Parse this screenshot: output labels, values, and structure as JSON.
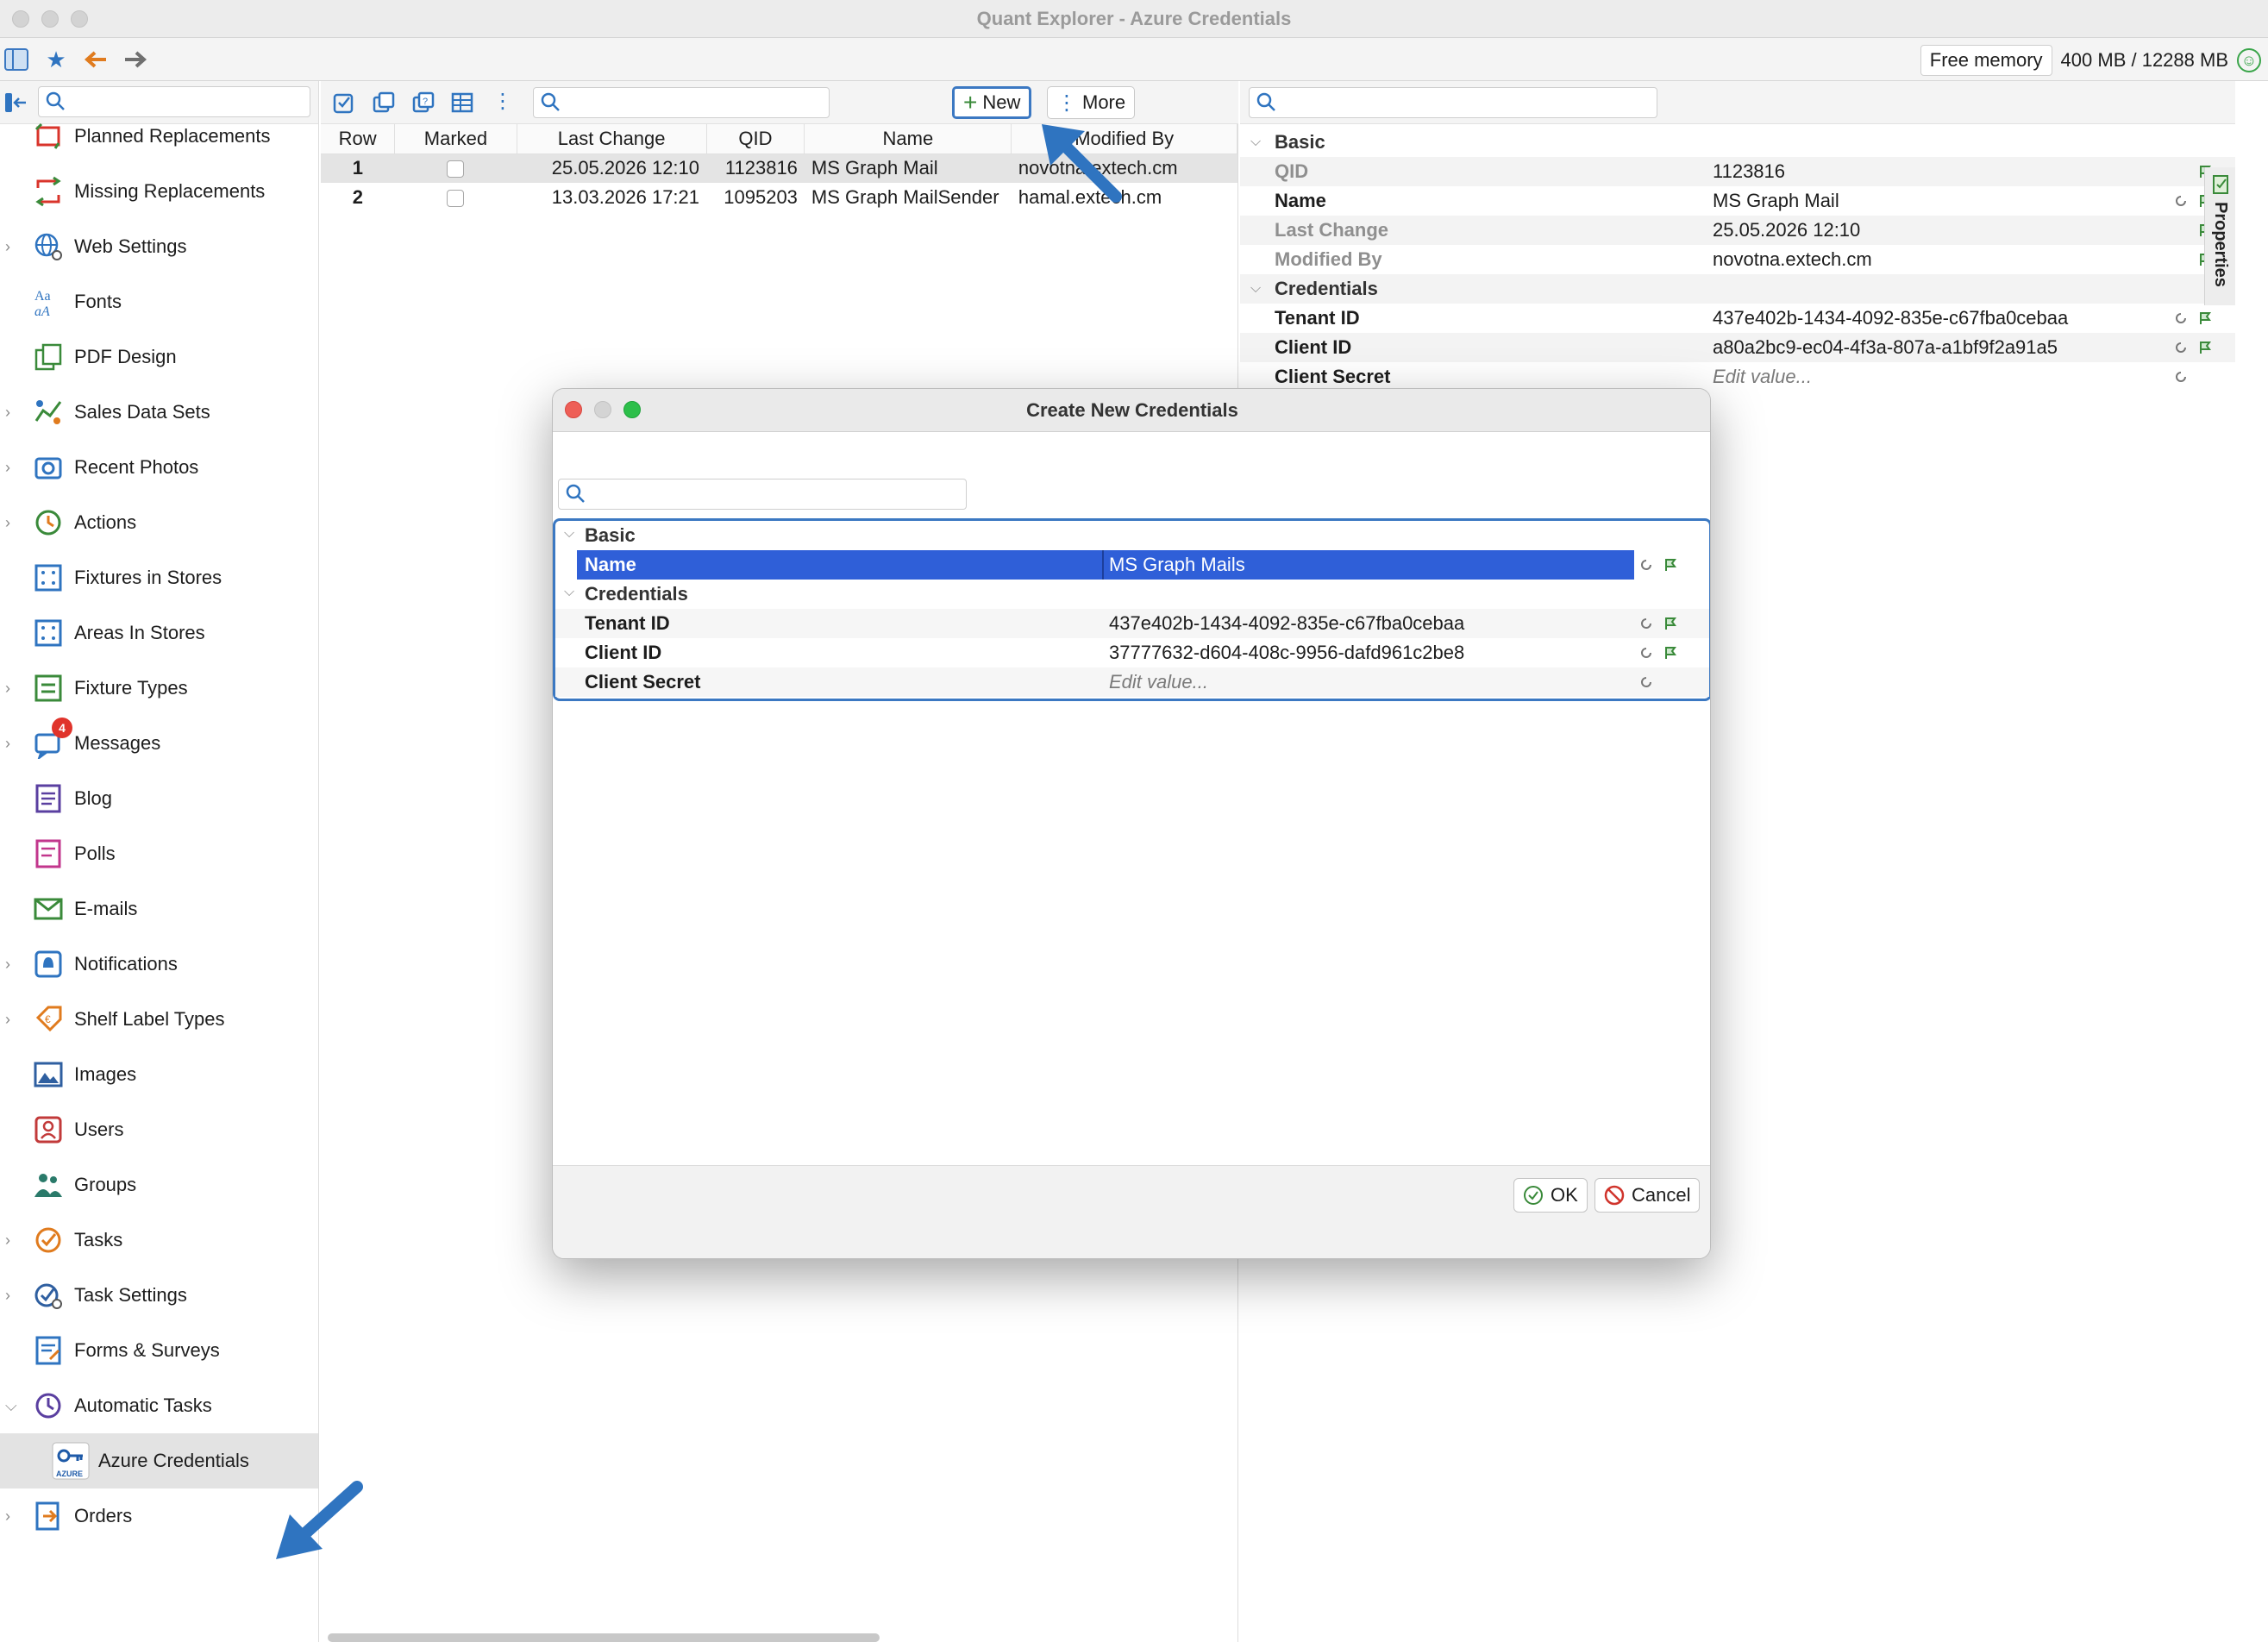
{
  "window": {
    "title": "Quant Explorer - Azure Credentials"
  },
  "memory": {
    "label": "Free memory",
    "value": "400 MB / 12288 MB"
  },
  "sidebar": {
    "items": [
      {
        "label": "Planned Replacements",
        "icon": "replace-icon",
        "expandable": false
      },
      {
        "label": "Missing Replacements",
        "icon": "missing-replace-icon",
        "expandable": false
      },
      {
        "label": "Web Settings",
        "icon": "globe-gear-icon",
        "expandable": true
      },
      {
        "label": "Fonts",
        "icon": "fonts-icon",
        "expandable": false
      },
      {
        "label": "PDF Design",
        "icon": "pdf-design-icon",
        "expandable": false
      },
      {
        "label": "Sales Data Sets",
        "icon": "sales-data-icon",
        "expandable": true
      },
      {
        "label": "Recent Photos",
        "icon": "camera-icon",
        "expandable": true
      },
      {
        "label": "Actions",
        "icon": "actions-icon",
        "expandable": true
      },
      {
        "label": "Fixtures in Stores",
        "icon": "fixtures-icon",
        "expandable": false
      },
      {
        "label": "Areas In Stores",
        "icon": "areas-icon",
        "expandable": false
      },
      {
        "label": "Fixture Types",
        "icon": "fixture-types-icon",
        "expandable": true
      },
      {
        "label": "Messages",
        "icon": "messages-icon",
        "expandable": true,
        "badge": "4"
      },
      {
        "label": "Blog",
        "icon": "blog-icon",
        "expandable": false
      },
      {
        "label": "Polls",
        "icon": "polls-icon",
        "expandable": false
      },
      {
        "label": "E-mails",
        "icon": "envelope-icon",
        "expandable": false
      },
      {
        "label": "Notifications",
        "icon": "bell-icon",
        "expandable": true
      },
      {
        "label": "Shelf Label Types",
        "icon": "price-tag-icon",
        "expandable": true
      },
      {
        "label": "Images",
        "icon": "image-icon",
        "expandable": false
      },
      {
        "label": "Users",
        "icon": "user-icon",
        "expandable": false
      },
      {
        "label": "Groups",
        "icon": "group-icon",
        "expandable": false
      },
      {
        "label": "Tasks",
        "icon": "task-check-icon",
        "expandable": true
      },
      {
        "label": "Task Settings",
        "icon": "task-settings-icon",
        "expandable": true
      },
      {
        "label": "Forms & Surveys",
        "icon": "forms-icon",
        "expandable": false
      },
      {
        "label": "Automatic Tasks",
        "icon": "clock-icon",
        "expandable": true,
        "expanded": true
      },
      {
        "label": "Azure Credentials",
        "icon": "azure-key-icon",
        "child": true,
        "selected": true,
        "icon_text": "AZURE"
      },
      {
        "label": "Orders",
        "icon": "orders-icon",
        "expandable": true
      }
    ]
  },
  "middle": {
    "toolbar": {
      "new_label": "New",
      "more_label": "More"
    },
    "columns": [
      "Row",
      "Marked",
      "Last Change",
      "QID",
      "Name",
      "Modified By"
    ],
    "rows": [
      {
        "row": "1",
        "last_change": "25.05.2026 12:10",
        "qid": "1123816",
        "name": "MS Graph Mail",
        "modified_by": "novotna.extech.cm"
      },
      {
        "row": "2",
        "last_change": "13.03.2026 17:21",
        "qid": "1095203",
        "name": "MS Graph MailSender",
        "modified_by": "hamal.extech.cm"
      }
    ]
  },
  "properties": {
    "tab_label": "Properties",
    "basic_label": "Basic",
    "credentials_label": "Credentials",
    "basic": [
      {
        "key": "QID",
        "value": "1123816"
      },
      {
        "key": "Name",
        "value": "MS Graph Mail"
      },
      {
        "key": "Last Change",
        "value": "25.05.2026 12:10"
      },
      {
        "key": "Modified By",
        "value": "novotna.extech.cm"
      }
    ],
    "credentials": [
      {
        "key": "Tenant ID",
        "value": "437e402b-1434-4092-835e-c67fba0cebaa"
      },
      {
        "key": "Client ID",
        "value": "a80a2bc9-ec04-4f3a-807a-a1bf9f2a91a5"
      },
      {
        "key": "Client Secret",
        "value": "Edit value..."
      }
    ]
  },
  "dialog": {
    "title": "Create New Credentials",
    "basic_label": "Basic",
    "credentials_label": "Credentials",
    "name_key": "Name",
    "name_value": "MS Graph Mails",
    "tenant_key": "Tenant ID",
    "tenant_value": "437e402b-1434-4092-835e-c67fba0cebaa",
    "client_id_key": "Client ID",
    "client_id_value": "37777632-d604-408c-9956-dafd961c2be8",
    "secret_key": "Client Secret",
    "secret_value": "Edit value...",
    "ok_label": "OK",
    "cancel_label": "Cancel"
  },
  "colors": {
    "accent": "#3b78c2",
    "selection": "#2f5fd8",
    "arrow": "#2f74c0"
  }
}
